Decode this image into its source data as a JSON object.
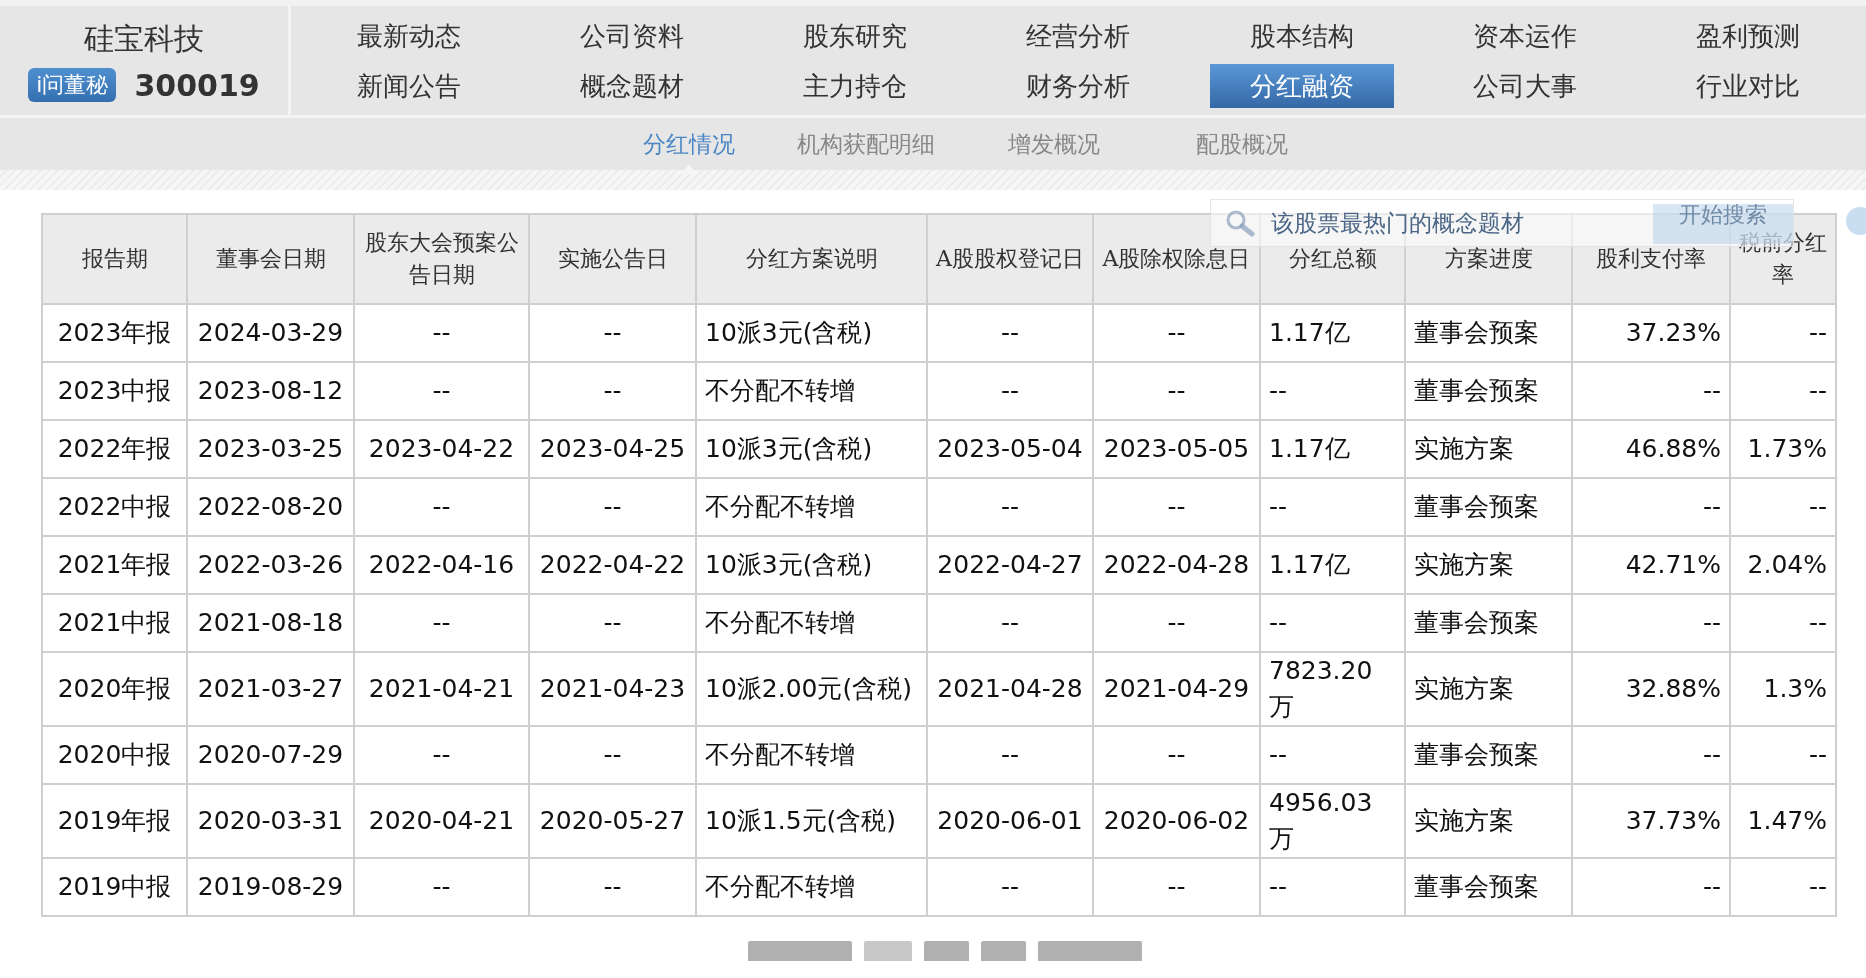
{
  "stock": {
    "name": "硅宝科技",
    "badge": "i问董秘",
    "code": "300019"
  },
  "nav": [
    {
      "label": "最新动态",
      "selected": false
    },
    {
      "label": "公司资料",
      "selected": false
    },
    {
      "label": "股东研究",
      "selected": false
    },
    {
      "label": "经营分析",
      "selected": false
    },
    {
      "label": "股本结构",
      "selected": false
    },
    {
      "label": "资本运作",
      "selected": false
    },
    {
      "label": "盈利预测",
      "selected": false
    },
    {
      "label": "新闻公告",
      "selected": false
    },
    {
      "label": "概念题材",
      "selected": false
    },
    {
      "label": "主力持仓",
      "selected": false
    },
    {
      "label": "财务分析",
      "selected": false
    },
    {
      "label": "分红融资",
      "selected": true
    },
    {
      "label": "公司大事",
      "selected": false
    },
    {
      "label": "行业对比",
      "selected": false
    }
  ],
  "subnav": [
    {
      "label": "分红情况",
      "selected": true
    },
    {
      "label": "机构获配明细",
      "selected": false
    },
    {
      "label": "增发概况",
      "selected": false
    },
    {
      "label": "配股概况",
      "selected": false
    }
  ],
  "search": {
    "placeholder": "该股票最热门的概念题材",
    "button": "开始搜索"
  },
  "table": {
    "columns": [
      "报告期",
      "董事会日期",
      "股东大会预案公告日期",
      "实施公告日",
      "分红方案说明",
      "A股股权登记日",
      "A股除权除息日",
      "分红总额",
      "方案进度",
      "股利支付率",
      "税前分红率"
    ],
    "rows": [
      [
        "2023年报",
        "2024-03-29",
        "--",
        "--",
        "10派3元(含税)",
        "--",
        "--",
        "1.17亿",
        "董事会预案",
        "37.23%",
        "--"
      ],
      [
        "2023中报",
        "2023-08-12",
        "--",
        "--",
        "不分配不转增",
        "--",
        "--",
        "--",
        "董事会预案",
        "--",
        "--"
      ],
      [
        "2022年报",
        "2023-03-25",
        "2023-04-22",
        "2023-04-25",
        "10派3元(含税)",
        "2023-05-04",
        "2023-05-05",
        "1.17亿",
        "实施方案",
        "46.88%",
        "1.73%"
      ],
      [
        "2022中报",
        "2022-08-20",
        "--",
        "--",
        "不分配不转增",
        "--",
        "--",
        "--",
        "董事会预案",
        "--",
        "--"
      ],
      [
        "2021年报",
        "2022-03-26",
        "2022-04-16",
        "2022-04-22",
        "10派3元(含税)",
        "2022-04-27",
        "2022-04-28",
        "1.17亿",
        "实施方案",
        "42.71%",
        "2.04%"
      ],
      [
        "2021中报",
        "2021-08-18",
        "--",
        "--",
        "不分配不转增",
        "--",
        "--",
        "--",
        "董事会预案",
        "--",
        "--"
      ],
      [
        "2020年报",
        "2021-03-27",
        "2021-04-21",
        "2021-04-23",
        "10派2.00元(含税)",
        "2021-04-28",
        "2021-04-29",
        "7823.20万",
        "实施方案",
        "32.88%",
        "1.3%"
      ],
      [
        "2020中报",
        "2020-07-29",
        "--",
        "--",
        "不分配不转增",
        "--",
        "--",
        "--",
        "董事会预案",
        "--",
        "--"
      ],
      [
        "2019年报",
        "2020-03-31",
        "2020-04-21",
        "2020-05-27",
        "10派1.5元(含税)",
        "2020-06-01",
        "2020-06-02",
        "4956.03万",
        "实施方案",
        "37.73%",
        "1.47%"
      ],
      [
        "2019中报",
        "2019-08-29",
        "--",
        "--",
        "不分配不转增",
        "--",
        "--",
        "--",
        "董事会预案",
        "--",
        "--"
      ]
    ]
  }
}
